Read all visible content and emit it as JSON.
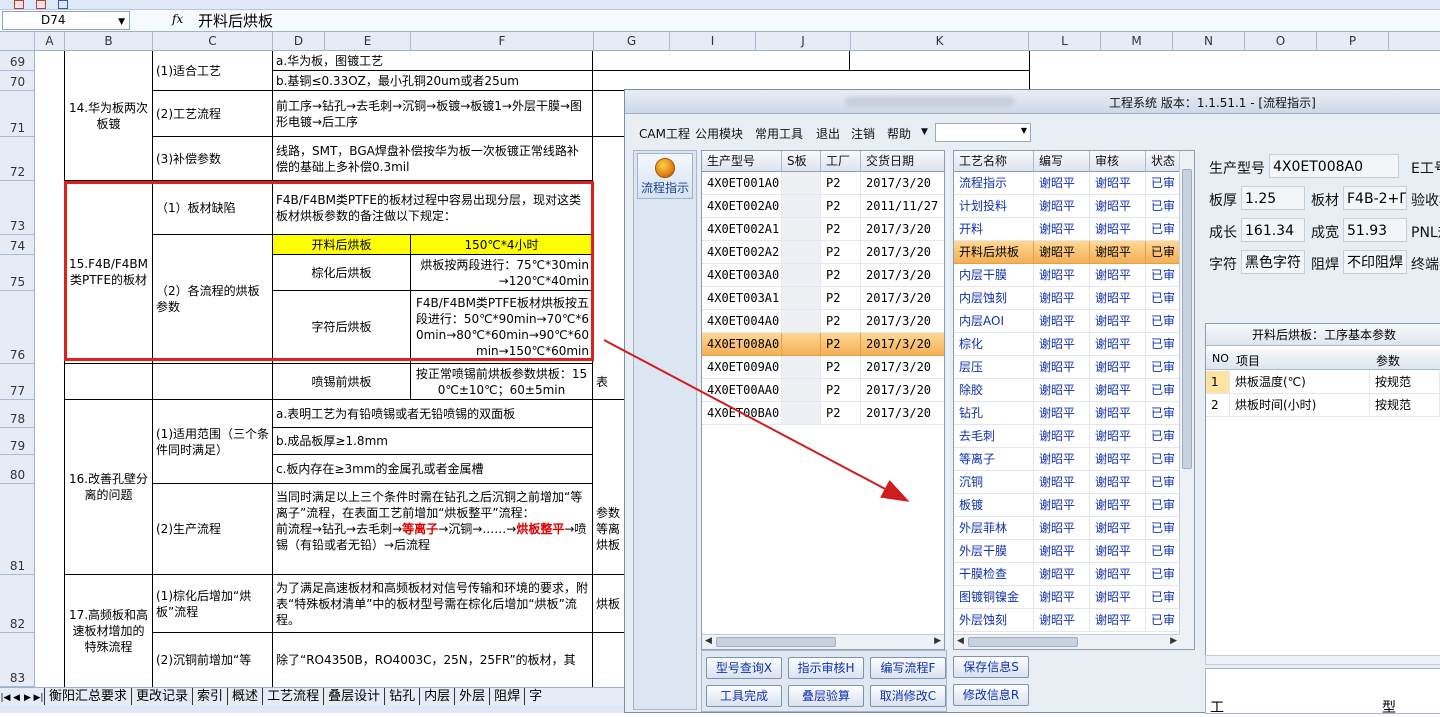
{
  "excel": {
    "name_box": "D74",
    "fx_label": "fx",
    "formula": "开料后烘板",
    "columns": [
      "A",
      "B",
      "C",
      "D",
      "E",
      "F",
      "G",
      "I",
      "J",
      "K",
      "L",
      "M",
      "N",
      "O",
      "P",
      "Q"
    ],
    "rows": [
      "69",
      "70",
      "71",
      "72",
      "73",
      "74",
      "75",
      "76",
      "77",
      "78",
      "79",
      "80",
      "81",
      "82",
      "83"
    ],
    "cells": {
      "b_14": "14.华为板两次板镀",
      "c69": "(1)适合工艺",
      "d69": "a.华为板，图镀工艺",
      "d70": "b.基铜≤0.33OZ，最小孔铜20um或者25um",
      "c71": "(2)工艺流程",
      "d71": "前工序→钻孔→去毛刺→沉铜→板镀→板镀1→外层干膜→图形电镀→后工序",
      "c72": "(3)补偿参数",
      "d72": "线路，SMT，BGA焊盘补偿按华为板一次板镀正常线路补偿的基础上多补偿0.3mil",
      "b_15": "15.F4B/F4BM类PTFE的板材",
      "c73": "（1）板材缺陷",
      "d73": "F4B/F4BM类PTFE的板材过程中容易出现分层，现对这类板材烘板参数的备注做以下规定：",
      "c74": "（2）各流程的烘板参数",
      "d74": "开料后烘板",
      "f74": "150℃*4小时",
      "d75": "棕化后烘板",
      "f75": "烘板按两段进行：75℃*30min→120℃*40min",
      "d76": "字符后烘板",
      "f76": "F4B/F4BM类PTFE板材烘板按五段进行：50℃*90min→70℃*60min→80℃*60min→90℃*60min→150℃*60min",
      "d77": "喷锡前烘板",
      "f77": "按正常喷锡前烘板参数烘板：150℃±10℃；60±5min",
      "i77": "表",
      "b_16": "16.改善孔壁分离的问题",
      "c78": "(1)适用范围（三个条件同时满足）",
      "d78": "a.表明工艺为有铅喷锡或者无铅喷锡的双面板",
      "d79": "b.成品板厚≥1.8mm",
      "d80": "c.板内存在≥3mm的金属孔或者金属槽",
      "c81": "(2)生产流程",
      "d81_a": "当同时满足以上三个条件时需在钻孔之后沉铜之前增加“等离子”流程，在表面工艺前增加“烘板整平”流程：",
      "d81_b": "前流程→钻孔→去毛刺→",
      "d81_c": "等离子",
      "d81_d": "→沉铜→……→",
      "d81_e": "烘板整平",
      "d81_f": "→喷锡（有铅或者无铅）→后流程",
      "i81": "参数等离烘板",
      "b_17": "17.高频板和高速板材增加的特殊流程",
      "c82": "(1)棕化后增加“烘板”流程",
      "d82": "为了满足高速板材和高频板材对信号传输和环境的要求，附表“特殊板材清单”中的板材型号需在棕化后增加“烘板”流程。",
      "i82": "烘板",
      "c83": "(2)沉铜前增加“等",
      "d83": "除了“RO4350B，RO4003C，25N，25FR”的板材，其"
    },
    "sheet_tabs": [
      "衡阳汇总要求",
      "更改记录",
      "索引",
      "概述",
      "工艺流程",
      "叠层设计",
      "钻孔",
      "内层",
      "外层",
      "阻焊",
      "字"
    ]
  },
  "app": {
    "title": "工程系统  版本：1.1.51.1 - [流程指示]",
    "menus": [
      "CAM工程",
      "公用模块",
      "常用工具",
      "退出",
      "注销",
      "帮助"
    ],
    "nav_button": "流程指示",
    "orders": {
      "headers": [
        "生产型号",
        "S板",
        "工厂",
        "交货日期"
      ],
      "selected_index": 7,
      "rows": [
        [
          "4X0ET001A0",
          "",
          "P2",
          "2017/3/20"
        ],
        [
          "4X0ET002A0",
          "",
          "P2",
          "2011/11/27"
        ],
        [
          "4X0ET002A1",
          "",
          "P2",
          "2017/3/20"
        ],
        [
          "4X0ET002A2",
          "",
          "P2",
          "2017/3/20"
        ],
        [
          "4X0ET003A0",
          "",
          "P2",
          "2017/3/20"
        ],
        [
          "4X0ET003A1",
          "",
          "P2",
          "2017/3/20"
        ],
        [
          "4X0ET004A0",
          "",
          "P2",
          "2017/3/20"
        ],
        [
          "4X0ET008A0",
          "",
          "P2",
          "2017/3/20"
        ],
        [
          "4X0ET009A0",
          "",
          "P2",
          "2017/3/20"
        ],
        [
          "4X0ET00AA0",
          "",
          "P2",
          "2017/3/20"
        ],
        [
          "4X0ET00BA0",
          "",
          "P2",
          "2017/3/20"
        ]
      ]
    },
    "process": {
      "headers": [
        "工艺名称",
        "编写",
        "审核",
        "状态"
      ],
      "selected_index": 3,
      "rows": [
        [
          "流程指示",
          "谢昭平",
          "谢昭平",
          "已审"
        ],
        [
          "计划投料",
          "谢昭平",
          "谢昭平",
          "已审"
        ],
        [
          "开料",
          "谢昭平",
          "谢昭平",
          "已审"
        ],
        [
          "开料后烘板",
          "谢昭平",
          "谢昭平",
          "已审"
        ],
        [
          "内层干膜",
          "谢昭平",
          "谢昭平",
          "已审"
        ],
        [
          "内层蚀刻",
          "谢昭平",
          "谢昭平",
          "已审"
        ],
        [
          "内层AOI",
          "谢昭平",
          "谢昭平",
          "已审"
        ],
        [
          "棕化",
          "谢昭平",
          "谢昭平",
          "已审"
        ],
        [
          "层压",
          "谢昭平",
          "谢昭平",
          "已审"
        ],
        [
          "除胶",
          "谢昭平",
          "谢昭平",
          "已审"
        ],
        [
          "钻孔",
          "谢昭平",
          "谢昭平",
          "已审"
        ],
        [
          "去毛刺",
          "谢昭平",
          "谢昭平",
          "已审"
        ],
        [
          "等离子",
          "谢昭平",
          "谢昭平",
          "已审"
        ],
        [
          "沉铜",
          "谢昭平",
          "谢昭平",
          "已审"
        ],
        [
          "板镀",
          "谢昭平",
          "谢昭平",
          "已审"
        ],
        [
          "外层菲林",
          "谢昭平",
          "谢昭平",
          "已审"
        ],
        [
          "外层干膜",
          "谢昭平",
          "谢昭平",
          "已审"
        ],
        [
          "干膜检查",
          "谢昭平",
          "谢昭平",
          "已审"
        ],
        [
          "图镀铜镍金",
          "谢昭平",
          "谢昭平",
          "已审"
        ],
        [
          "外层蚀刻",
          "谢昭平",
          "谢昭平",
          "已审"
        ]
      ]
    },
    "buttons": [
      "型号查询X",
      "指示审核H",
      "编写流程F",
      "保存信息S",
      "工具完成",
      "叠层验算",
      "取消修改C",
      "修改信息R"
    ],
    "info": {
      "model_label": "生产型号",
      "model_value": "4X0ET008A0",
      "e_label": "E工号",
      "thick_label": "板厚",
      "thick_value": "1.25",
      "mat_label": "板材",
      "mat_value": "F4B-2+П",
      "verify_label": "验收板",
      "len_label": "成长",
      "len_value": "161.34",
      "wid_label": "成宽",
      "wid_value": "51.93",
      "pnl_label": "PNL规",
      "char_label": "字符",
      "char_value": "黑色字符",
      "mask_label": "阻焊",
      "mask_value": "不印阻焊",
      "final_label": "终端客"
    },
    "param": {
      "title": "开料后烘板：工序基本参数",
      "headers": [
        "NO",
        "项目",
        "参数"
      ],
      "rows": [
        [
          "1",
          "烘板温度(℃)",
          "按规范"
        ],
        [
          "2",
          "烘板时间(小时)",
          "按规范"
        ]
      ]
    },
    "bottom_labels": [
      "工",
      "型"
    ]
  }
}
